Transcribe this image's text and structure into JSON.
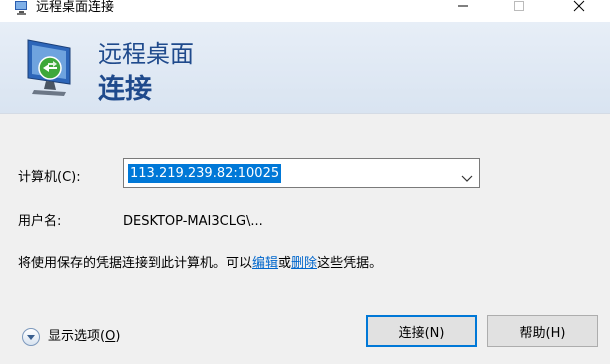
{
  "window": {
    "title": "远程桌面连接",
    "icon": "remote-desktop-icon"
  },
  "banner": {
    "line1": "远程桌面",
    "line2": "连接",
    "icon": "computer-connect-icon"
  },
  "form": {
    "computer_label": "计算机(C):",
    "computer_value": "113.219.239.82:10025",
    "user_label": "用户名:",
    "user_value": "DESKTOP-MAI3CLG\\..."
  },
  "info": {
    "prefix": "将使用保存的凭据连接到此计算机。可以",
    "edit_link": "编辑",
    "middle": "或",
    "delete_link": "删除",
    "suffix": "这些凭据。"
  },
  "footer": {
    "options_label": "显示选项(",
    "options_key": "O",
    "options_suffix": ")",
    "connect_label": "连接(N)",
    "help_label": "帮助(H)"
  },
  "colors": {
    "accent": "#0078d7",
    "banner_text": "#1f4a8c",
    "link": "#0066cc"
  }
}
